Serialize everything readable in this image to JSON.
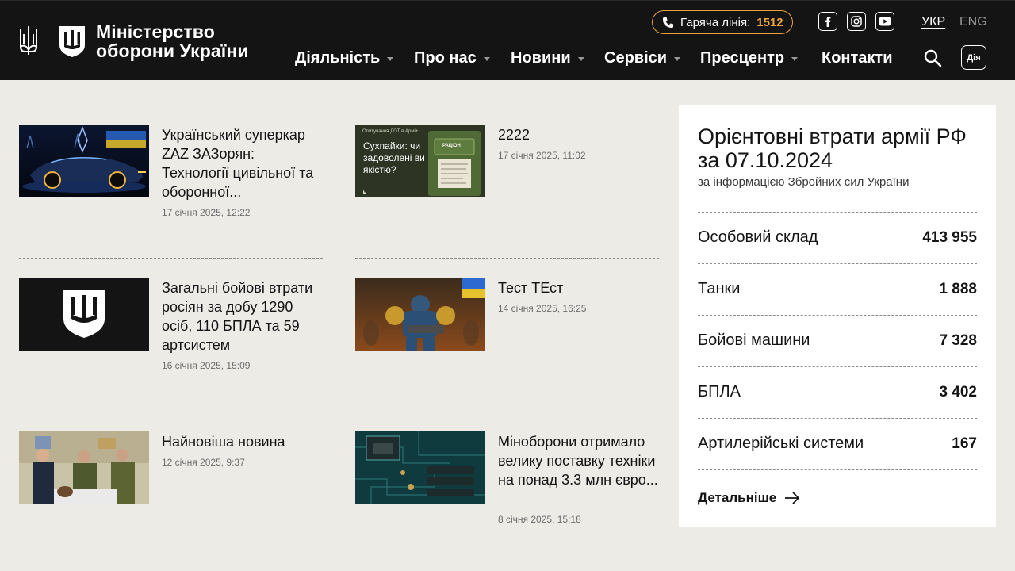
{
  "header": {
    "logo_line1": "Міністерство",
    "logo_line2": "оборони України",
    "hotline_label": "Гаряча лінія:",
    "hotline_number": "1512",
    "lang_ua": "УКР",
    "lang_en": "ENG",
    "diia_label": "Дія",
    "nav": [
      {
        "label": "Діяльність",
        "has_dropdown": true
      },
      {
        "label": "Про нас",
        "has_dropdown": true
      },
      {
        "label": "Новини",
        "has_dropdown": true
      },
      {
        "label": "Сервіси",
        "has_dropdown": true
      },
      {
        "label": "Пресцентр",
        "has_dropdown": true
      },
      {
        "label": "Контакти",
        "has_dropdown": false
      }
    ],
    "social": [
      "facebook-icon",
      "instagram-icon",
      "youtube-icon"
    ]
  },
  "news": [
    {
      "title": "Український суперкар ZAZ ЗАЗорян: Технології цивільної та оборонної...",
      "date": "17 січня 2025, 12:22"
    },
    {
      "title": "2222",
      "date": "17 січня 2025, 11:02",
      "thumb_text": "Сухпайки: чи задоволені ви якістю?",
      "thumb_kicker": "Опитування ДОТ в Армі+",
      "thumb_pack": "РАЦІОН"
    },
    {
      "title": "Загальні бойові втрати росіян за добу 1290 осіб, 110 БПЛА та 59 артсистем",
      "date": "16 січня 2025, 15:09"
    },
    {
      "title": "Тест ТЕст",
      "date": "14 січня 2025, 16:25"
    },
    {
      "title": "Найновіша новина",
      "date": "12 січня 2025, 9:37"
    },
    {
      "title": "Міноборони отримало велику поставку техніки на понад 3.3 млн євро...",
      "date": "8 січня 2025, 15:18"
    }
  ],
  "losses": {
    "title": "Орієнтовні втрати армії РФ за 07.10.2024",
    "subtitle": "за інформацією Збройних сил України",
    "rows": [
      {
        "label": "Особовий склад",
        "value": "413 955"
      },
      {
        "label": "Танки",
        "value": "1 888"
      },
      {
        "label": "Бойові машини",
        "value": "7 328"
      },
      {
        "label": "БПЛА",
        "value": "3 402"
      },
      {
        "label": "Артилерійські системи",
        "value": "167"
      }
    ],
    "more_label": "Детальніше"
  },
  "colors": {
    "header_bg": "#141414",
    "page_bg": "#edebe6",
    "accent": "#f0a93c"
  }
}
